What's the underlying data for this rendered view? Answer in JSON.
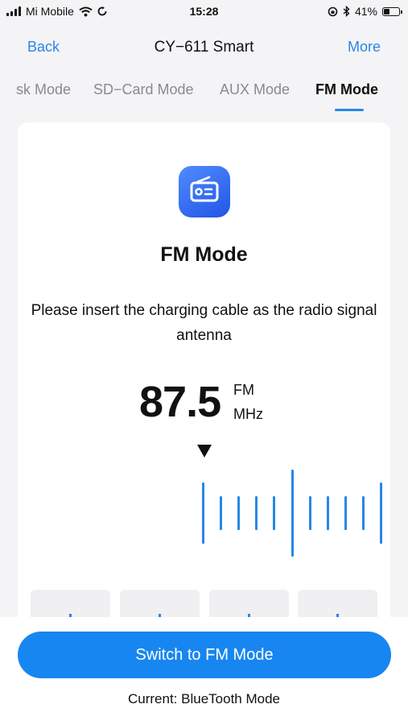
{
  "status_bar": {
    "carrier": "Mi Mobile",
    "time": "15:28",
    "battery_percent": "41%",
    "battery_level": 0.41,
    "icons": [
      "signal-icon",
      "wifi-icon",
      "sync-icon",
      "orientation-lock-icon",
      "bluetooth-icon",
      "battery-icon"
    ]
  },
  "nav": {
    "back_label": "Back",
    "title": "CY−611 Smart",
    "more_label": "More"
  },
  "tabs": [
    {
      "label": "sk Mode",
      "active": false
    },
    {
      "label": "SD−Card Mode",
      "active": false
    },
    {
      "label": "AUX Mode",
      "active": false
    },
    {
      "label": "FM Mode",
      "active": true
    }
  ],
  "card": {
    "icon": "radio-icon",
    "title": "FM Mode",
    "hint": "Please insert the charging cable as the radio signal antenna",
    "frequency": "87.5",
    "band": "FM",
    "unit": "MHz"
  },
  "footer": {
    "switch_label": "Switch to FM Mode",
    "current_label": "Current: BlueTooth Mode"
  },
  "colors": {
    "accent": "#2a86e8",
    "button": "#1886f0",
    "icon_gradient_start": "#4f8cff",
    "icon_gradient_end": "#2355e6"
  }
}
